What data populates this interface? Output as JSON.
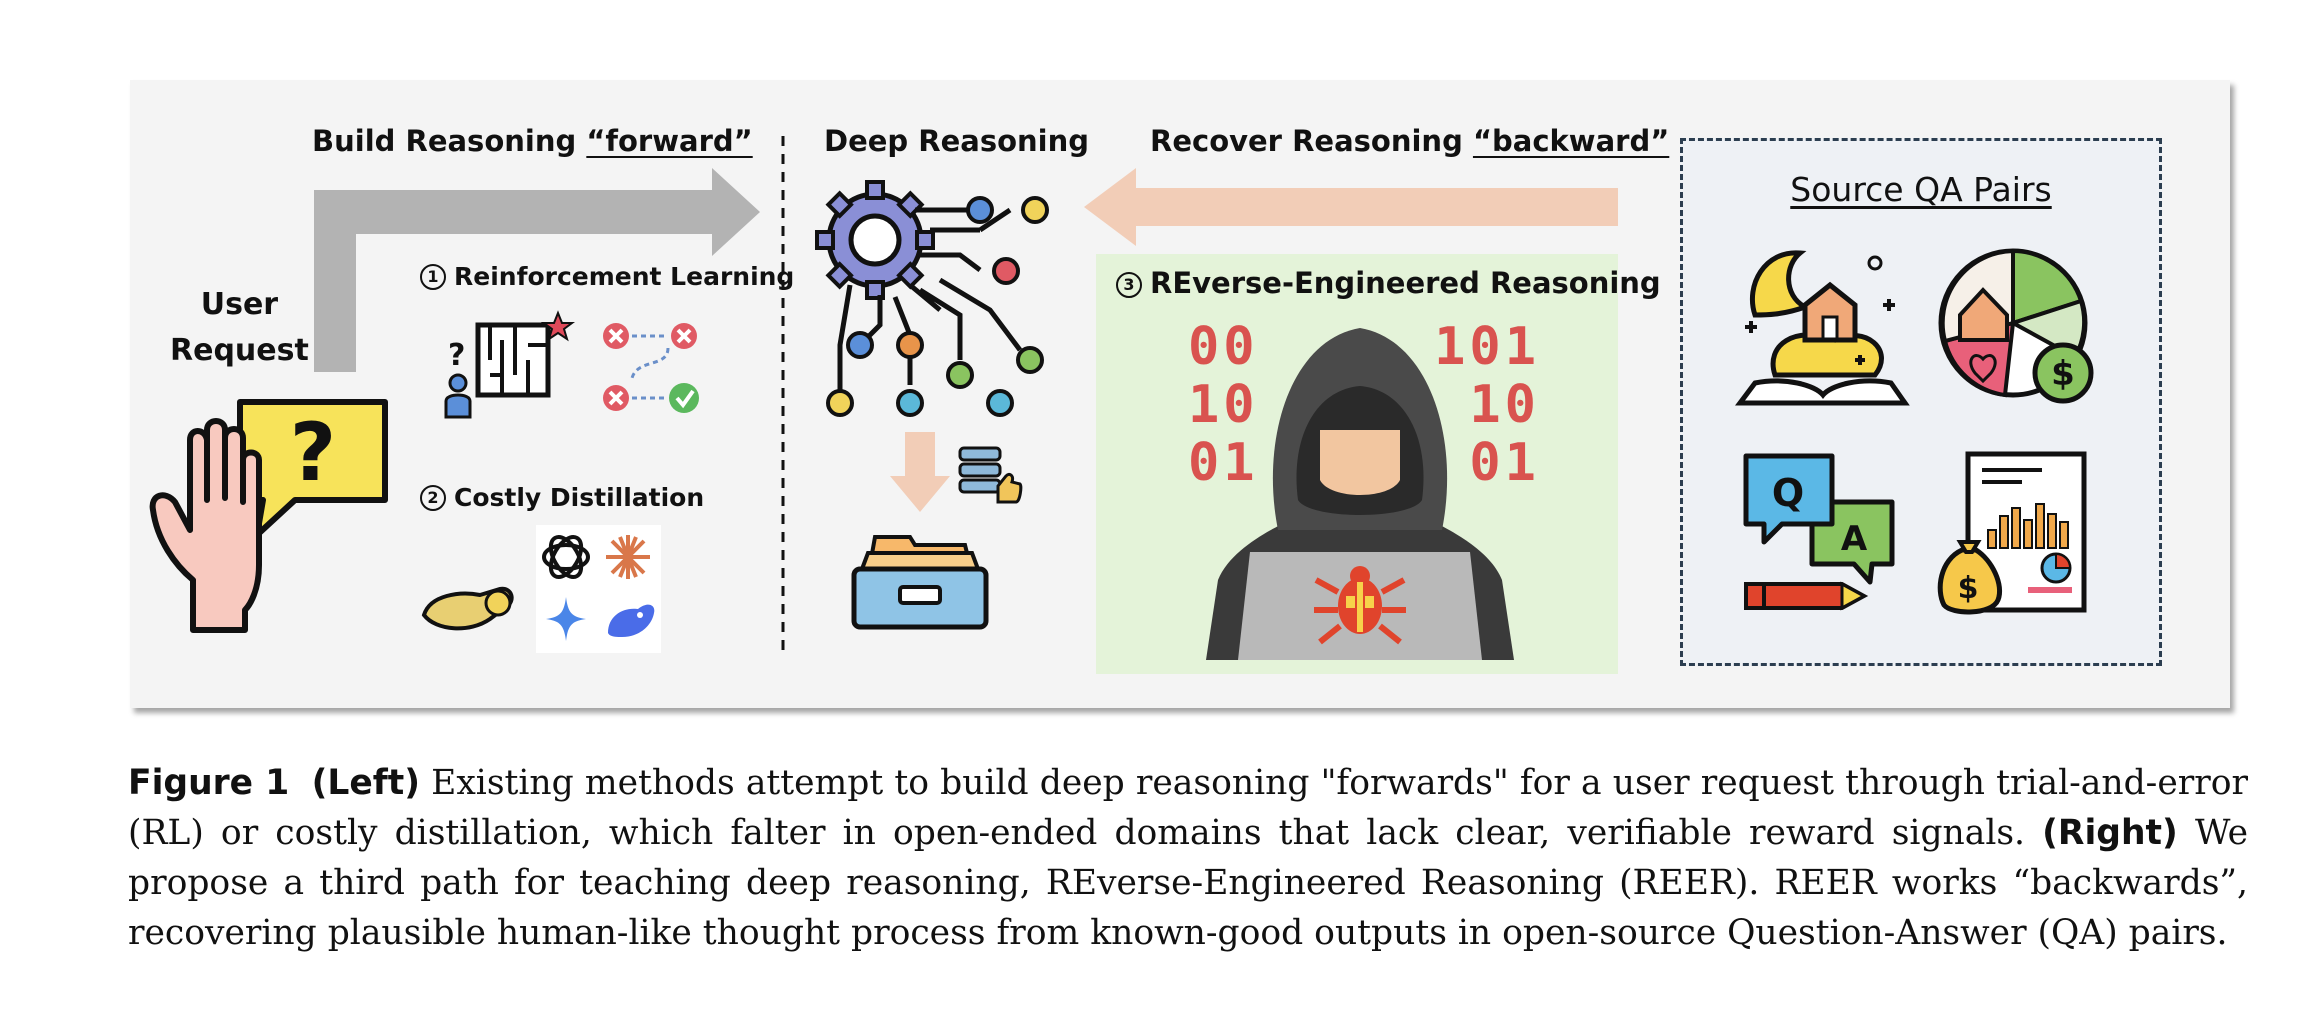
{
  "diagram": {
    "left": {
      "forward_title": "Build Reasoning ",
      "forward_word": "“forward”",
      "user_request_line1": "User",
      "user_request_line2": "Request",
      "method1_num": "1",
      "method1_label": "Reinforcement Learning",
      "method2_num": "2",
      "method2_label": "Costly Distillation"
    },
    "center": {
      "title": "Deep Reasoning"
    },
    "right": {
      "backward_title": "Recover Reasoning ",
      "backward_word": "“backward”",
      "method3_num": "3",
      "method3_label": "REverse-Engineered Reasoning",
      "binary_left": [
        "00",
        "10",
        "01"
      ],
      "binary_right": [
        "101",
        "10",
        "01"
      ]
    },
    "source": {
      "title": "Source QA Pairs",
      "q_letter": "Q",
      "a_letter": "A",
      "dollar": "$"
    },
    "colors": {
      "forward_arrow": "#b3b3b3",
      "backward_arrow": "#f2cdb7",
      "reer_box": "#e4f3d9",
      "source_border": "#2c3e50"
    }
  },
  "caption": {
    "figure_label": "Figure 1",
    "left_tag": "(Left)",
    "text1": " Existing methods attempt to build deep reasoning \"forwards\" for a user request through trial-and-error (RL) or costly distillation, which falter in open-ended domains that lack clear, verifiable reward signals. ",
    "right_tag": "(Right)",
    "text2": " We propose a third path for teaching deep reasoning, REverse-Engineered Reasoning (REER). REER works “backwards”, recovering plausible human-like thought process from known-good outputs in open-source Question-Answer (QA) pairs."
  }
}
